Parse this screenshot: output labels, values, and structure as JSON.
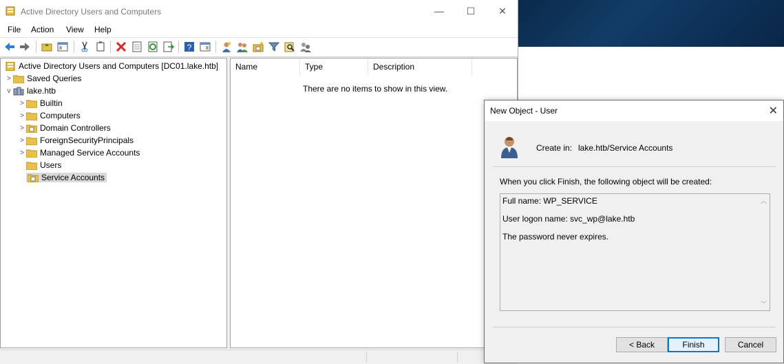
{
  "window": {
    "title": "Active Directory Users and Computers",
    "minimize": "—",
    "maximize": "☐",
    "close": "✕"
  },
  "menu": {
    "items": [
      "File",
      "Action",
      "View",
      "Help"
    ]
  },
  "toolbar": {
    "buttons": [
      "back-arrow",
      "forward-arrow",
      "up-folder",
      "show-console-tree",
      "cut",
      "copy",
      "delete",
      "properties",
      "refresh",
      "export-list",
      "help",
      "show-action-pane",
      "new-user",
      "new-group",
      "new-ou",
      "filter",
      "find",
      "add-to-group"
    ]
  },
  "tree": {
    "root": "Active Directory Users and Computers [DC01.lake.htb]",
    "items": [
      {
        "label": "Saved Queries",
        "expander": ">"
      },
      {
        "label": "lake.htb",
        "expander": "v"
      },
      {
        "label": "Builtin",
        "expander": ">"
      },
      {
        "label": "Computers",
        "expander": ">"
      },
      {
        "label": "Domain Controllers",
        "expander": ">"
      },
      {
        "label": "ForeignSecurityPrincipals",
        "expander": ">"
      },
      {
        "label": "Managed Service Accounts",
        "expander": ">"
      },
      {
        "label": "Users",
        "expander": ""
      },
      {
        "label": "Service Accounts",
        "expander": ""
      }
    ],
    "selected": "Service Accounts"
  },
  "list": {
    "columns": [
      "Name",
      "Type",
      "Description"
    ],
    "empty_message": "There are no items to show in this view."
  },
  "dialog": {
    "title": "New Object - User",
    "close": "✕",
    "create_in_label": "Create in:",
    "create_in_value": "lake.htb/Service Accounts",
    "finish_message": "When you click Finish, the following object will be created:",
    "summary": {
      "full_name": "Full name: WP_SERVICE",
      "logon_name": "User logon name: svc_wp@lake.htb",
      "password_note": "The password never expires."
    },
    "buttons": {
      "back": "< Back",
      "finish": "Finish",
      "cancel": "Cancel"
    }
  },
  "colors": {
    "desktop": "#123c66",
    "accent": "#0078d7",
    "selection": "#d9d9d9",
    "folder": "#e8c04a"
  }
}
